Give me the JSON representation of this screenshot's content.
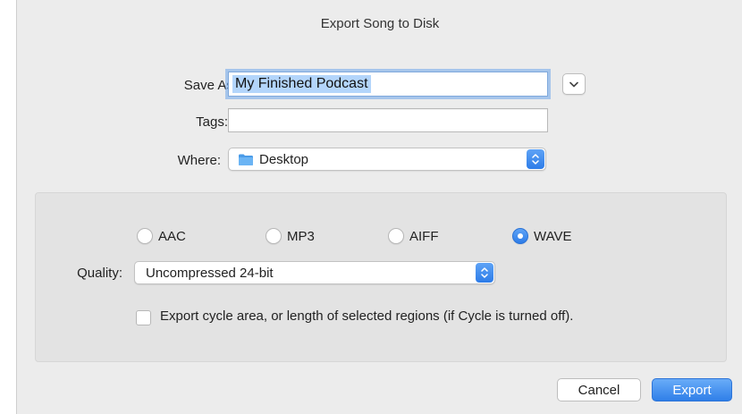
{
  "dialog": {
    "title": "Export Song to Disk"
  },
  "form": {
    "save_as_label": "Save As:",
    "save_as_value": "My Finished Podcast",
    "tags_label": "Tags:",
    "tags_value": "",
    "where_label": "Where:",
    "where_value": "Desktop"
  },
  "format": {
    "options": [
      "AAC",
      "MP3",
      "AIFF",
      "WAVE"
    ],
    "selected": "WAVE"
  },
  "quality": {
    "label": "Quality:",
    "value": "Uncompressed 24-bit"
  },
  "cycle_checkbox": {
    "label": "Export cycle area, or length of selected regions (if Cycle is turned off).",
    "checked": false
  },
  "buttons": {
    "cancel": "Cancel",
    "export": "Export"
  },
  "colors": {
    "accent": "#2f7fe8",
    "selection": "#b3d5fb",
    "folder": "#4a9be8"
  }
}
